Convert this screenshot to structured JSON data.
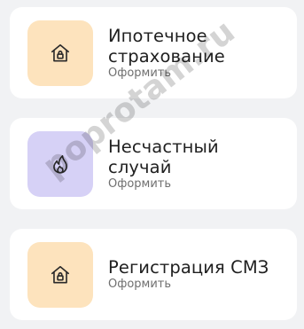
{
  "cards": [
    {
      "title_line1": "Ипотечное",
      "title_line2": "страхование",
      "subtitle": "Оформить",
      "icon": "house-lock-icon",
      "icon_bg": "#fde3bd"
    },
    {
      "title_line1": "Несчастный",
      "title_line2": "случай",
      "subtitle": "Оформить",
      "icon": "flame-icon",
      "icon_bg": "#d6d1f6"
    },
    {
      "title_line1": "Регистрация СМЗ",
      "subtitle": "Оформить",
      "icon": "house-lock-icon",
      "icon_bg": "#fde3bd"
    }
  ],
  "watermark": "poprotam.ru"
}
